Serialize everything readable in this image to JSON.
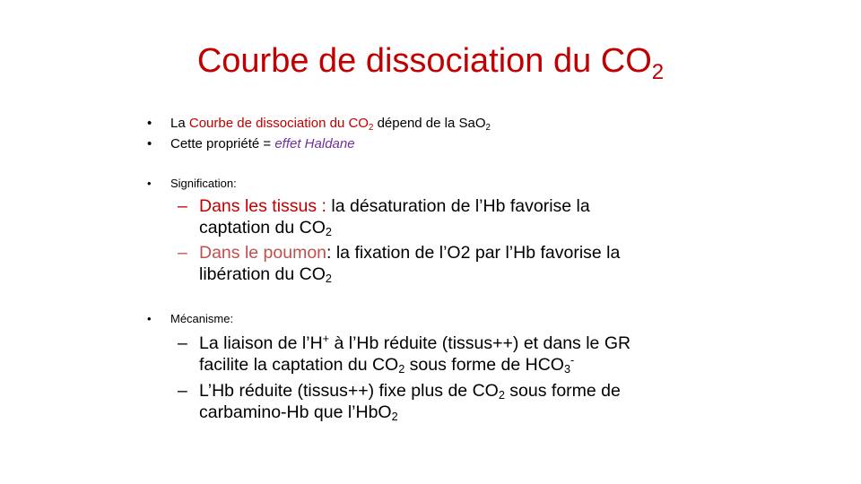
{
  "slide": {
    "title": {
      "main": "Courbe de dissociation du CO",
      "sub": "2"
    },
    "bullets": [
      {
        "bullet": "•",
        "prefix": "La ",
        "highlight": "Courbe de dissociation du CO",
        "highlight_sub": "2",
        "mid": " dépend de la SaO",
        "mid_sub": "2"
      },
      {
        "bullet": "•",
        "prefix": "Cette propriété = ",
        "highlight": "effet Haldane"
      }
    ],
    "signification": {
      "bullet": "•",
      "label": "Signification:",
      "items": [
        {
          "dash": "–",
          "highlight": "Dans les tissus :",
          "line1": " la désaturation de l’Hb favorise la",
          "line2": "captation du CO",
          "line2_sub": "2"
        },
        {
          "dash": "–",
          "highlight": "Dans le poumon",
          "line1": ": la fixation de l’O2 par l’Hb favorise la",
          "line2": "libération du CO",
          "line2_sub": "2"
        }
      ]
    },
    "mecanisme": {
      "bullet": "•",
      "label": "Mécanisme:",
      "items": [
        {
          "dash": "–",
          "line1_a": "La liaison de l’H",
          "line1_sup": "+",
          "line1_b": " à l’Hb réduite (tissus++) et dans le GR",
          "line2_a": "facilite la captation du CO",
          "line2_sub": "2",
          "line2_b": " sous forme de HCO",
          "line2_sub2": "3",
          "line2_sup": "-"
        },
        {
          "dash": "–",
          "line1_a": "L’Hb réduite (tissus++) fixe plus de CO",
          "line1_sub": "2",
          "line1_b": " sous forme de",
          "line2_a": "carbamino-Hb que l’HbO",
          "line2_sub": "2"
        }
      ]
    },
    "colors": {
      "title": "#c00000",
      "highlight": "#c00000",
      "rose": "#c0504d",
      "haldane": "#7030a0"
    }
  }
}
